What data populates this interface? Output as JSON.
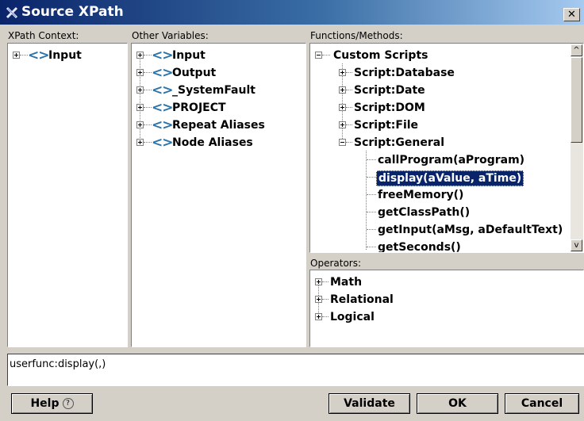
{
  "window": {
    "title": "Source XPath",
    "icon": "xpath-editor-icon",
    "close_glyph": "✕"
  },
  "panels": {
    "xpath_context": {
      "label": "XPath Context:",
      "items": [
        {
          "label": "Input",
          "icon": "chevrons-icon",
          "expanded": false
        }
      ]
    },
    "other_variables": {
      "label": "Other Variables:",
      "items": [
        {
          "label": "Input",
          "icon": "chevrons-icon",
          "expanded": false
        },
        {
          "label": "Output",
          "icon": "chevrons-icon",
          "expanded": false
        },
        {
          "label": "_SystemFault",
          "icon": "chevrons-icon",
          "expanded": false
        },
        {
          "label": "PROJECT",
          "icon": "chevrons-icon",
          "expanded": false
        },
        {
          "label": "Repeat Aliases",
          "icon": "chevrons-icon",
          "expanded": false
        },
        {
          "label": "Node Aliases",
          "icon": "chevrons-icon",
          "expanded": false
        }
      ]
    },
    "functions_methods": {
      "label": "Functions/Methods:",
      "root": {
        "label": "Custom Scripts",
        "expanded": true
      },
      "groups": [
        {
          "label": "Script:Database",
          "expanded": false
        },
        {
          "label": "Script:Date",
          "expanded": false
        },
        {
          "label": "Script:DOM",
          "expanded": false
        },
        {
          "label": "Script:File",
          "expanded": false
        },
        {
          "label": "Script:General",
          "expanded": true
        }
      ],
      "functions": [
        {
          "label": "callProgram(aProgram)",
          "selected": false
        },
        {
          "label": "display(aValue, aTime)",
          "selected": true
        },
        {
          "label": "freeMemory()",
          "selected": false
        },
        {
          "label": "getClassPath()",
          "selected": false
        },
        {
          "label": "getInput(aMsg, aDefaultText)",
          "selected": false
        },
        {
          "label": "getSeconds()",
          "selected": false
        }
      ]
    },
    "operators": {
      "label": "Operators:",
      "items": [
        {
          "label": "Math",
          "expanded": false
        },
        {
          "label": "Relational",
          "expanded": false
        },
        {
          "label": "Logical",
          "expanded": false
        }
      ]
    }
  },
  "expression": {
    "value": "userfunc:display(,)"
  },
  "buttons": {
    "help": "Help",
    "help_icon": "?",
    "validate": "Validate",
    "ok": "OK",
    "cancel": "Cancel"
  },
  "scrollbar": {
    "up": "^",
    "down": "v"
  },
  "colors": {
    "accent_chevrons": "#2e73a8",
    "selection": "#0a246a",
    "title_gradient_start": "#0a246a",
    "window_bg": "#d4d0c8"
  }
}
